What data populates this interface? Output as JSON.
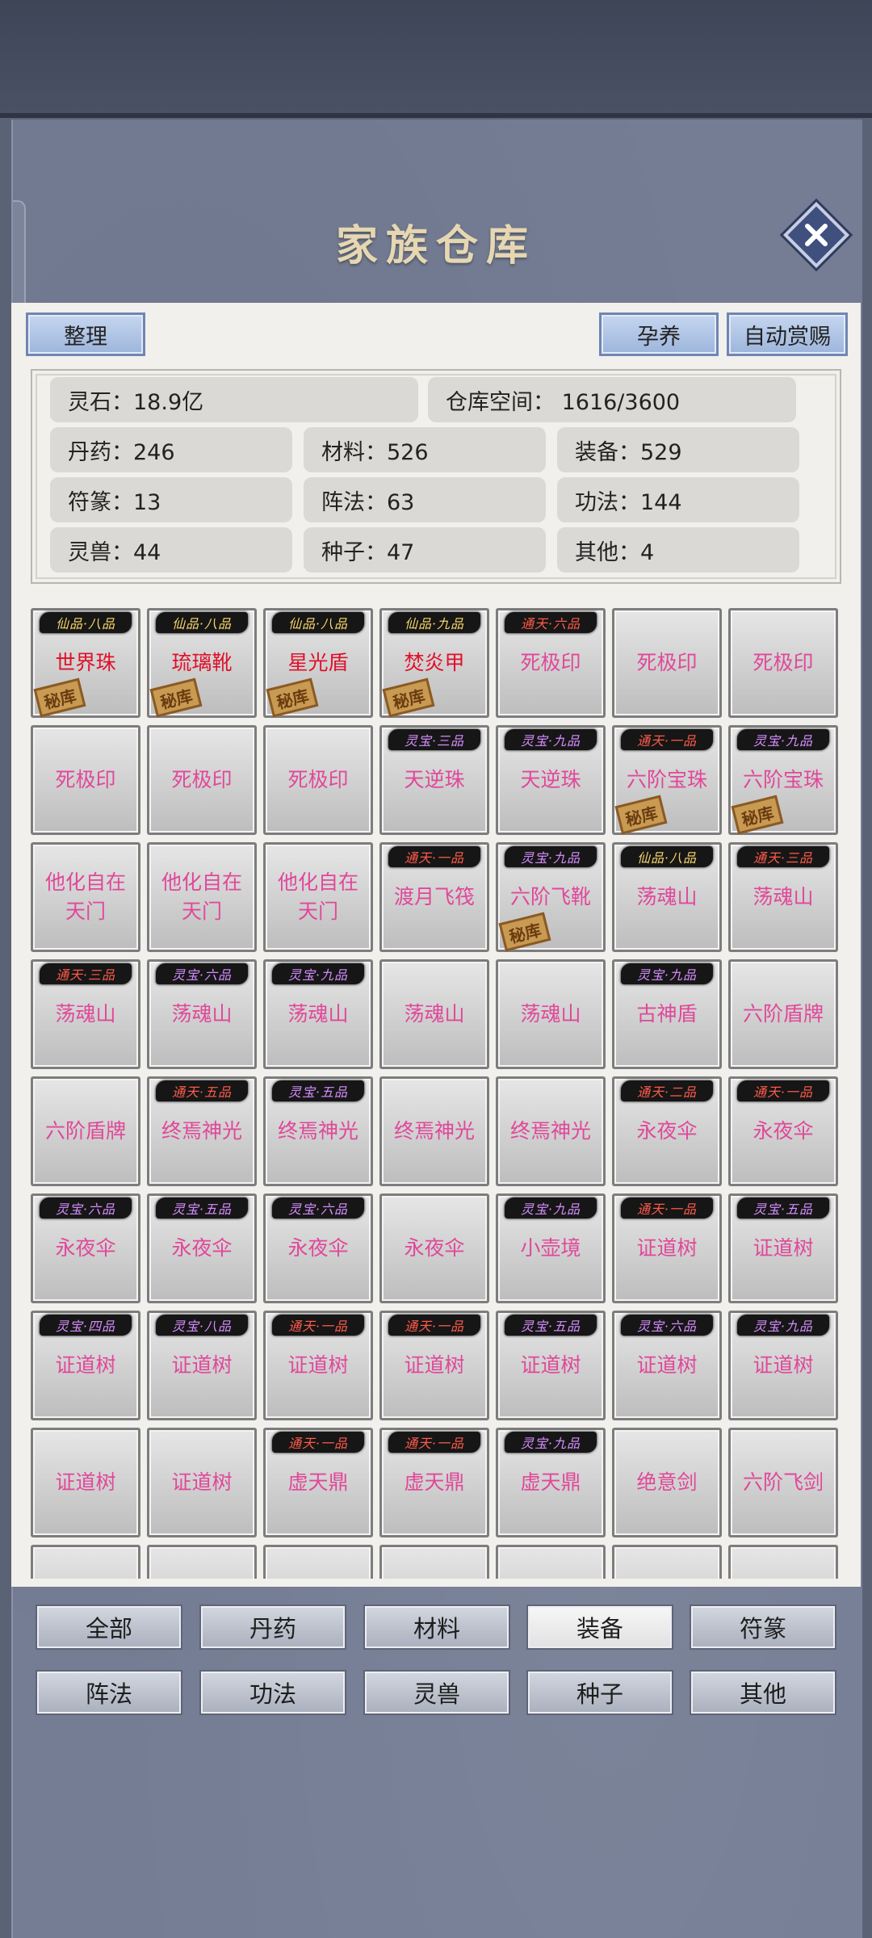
{
  "title": "家族仓库",
  "buttons": {
    "organize": "整理",
    "nurture": "孕养",
    "auto_reward": "自动赏赐"
  },
  "stats": {
    "spirit_stone": "灵石：18.9亿",
    "storage_space": "仓库空间：   1616/3600",
    "pills": "丹药：246",
    "materials": "材料：526",
    "equipment": "装备：529",
    "talismans": "符篆：13",
    "formations": "阵法：63",
    "techniques": "功法：144",
    "beasts": "灵兽：44",
    "seeds": "种子：47",
    "others": "其他：4"
  },
  "stamp_text": "秘库",
  "items": [
    {
      "badge": "仙品·八品",
      "badge_color": "gold",
      "name": "世界珠",
      "name_color": "red",
      "stamp": true
    },
    {
      "badge": "仙品·八品",
      "badge_color": "gold",
      "name": "琉璃靴",
      "name_color": "red",
      "stamp": true
    },
    {
      "badge": "仙品·八品",
      "badge_color": "gold",
      "name": "星光盾",
      "name_color": "red",
      "stamp": true
    },
    {
      "badge": "仙品·九品",
      "badge_color": "gold",
      "name": "焚炎甲",
      "name_color": "red",
      "stamp": true
    },
    {
      "badge": "通天·六品",
      "badge_color": "red",
      "name": "死极印",
      "name_color": "pink",
      "stamp": false
    },
    {
      "badge": "",
      "badge_color": "",
      "name": "死极印",
      "name_color": "pink",
      "stamp": false
    },
    {
      "badge": "",
      "badge_color": "",
      "name": "死极印",
      "name_color": "pink",
      "stamp": false
    },
    {
      "badge": "",
      "badge_color": "",
      "name": "死极印",
      "name_color": "pink",
      "stamp": false
    },
    {
      "badge": "",
      "badge_color": "",
      "name": "死极印",
      "name_color": "pink",
      "stamp": false
    },
    {
      "badge": "",
      "badge_color": "",
      "name": "死极印",
      "name_color": "pink",
      "stamp": false
    },
    {
      "badge": "灵宝·三品",
      "badge_color": "purple",
      "name": "天逆珠",
      "name_color": "pink",
      "stamp": false
    },
    {
      "badge": "灵宝·九品",
      "badge_color": "purple",
      "name": "天逆珠",
      "name_color": "pink",
      "stamp": false
    },
    {
      "badge": "通天·一品",
      "badge_color": "red",
      "name": "六阶宝珠",
      "name_color": "pink",
      "stamp": true
    },
    {
      "badge": "灵宝·九品",
      "badge_color": "purple",
      "name": "六阶宝珠",
      "name_color": "pink",
      "stamp": true
    },
    {
      "badge": "",
      "badge_color": "",
      "name": "他化自在天门",
      "name_color": "pink",
      "stamp": false
    },
    {
      "badge": "",
      "badge_color": "",
      "name": "他化自在天门",
      "name_color": "pink",
      "stamp": false
    },
    {
      "badge": "",
      "badge_color": "",
      "name": "他化自在天门",
      "name_color": "pink",
      "stamp": false
    },
    {
      "badge": "通天·一品",
      "badge_color": "red",
      "name": "渡月飞筏",
      "name_color": "pink",
      "stamp": false
    },
    {
      "badge": "灵宝·九品",
      "badge_color": "purple",
      "name": "六阶飞靴",
      "name_color": "pink",
      "stamp": true
    },
    {
      "badge": "仙品·八品",
      "badge_color": "gold",
      "name": "荡魂山",
      "name_color": "pink",
      "stamp": false
    },
    {
      "badge": "通天·三品",
      "badge_color": "red",
      "name": "荡魂山",
      "name_color": "pink",
      "stamp": false
    },
    {
      "badge": "通天·三品",
      "badge_color": "red",
      "name": "荡魂山",
      "name_color": "pink",
      "stamp": false
    },
    {
      "badge": "灵宝·六品",
      "badge_color": "purple",
      "name": "荡魂山",
      "name_color": "pink",
      "stamp": false
    },
    {
      "badge": "灵宝·九品",
      "badge_color": "purple",
      "name": "荡魂山",
      "name_color": "pink",
      "stamp": false
    },
    {
      "badge": "",
      "badge_color": "",
      "name": "荡魂山",
      "name_color": "pink",
      "stamp": false
    },
    {
      "badge": "",
      "badge_color": "",
      "name": "荡魂山",
      "name_color": "pink",
      "stamp": false
    },
    {
      "badge": "灵宝·九品",
      "badge_color": "purple",
      "name": "古神盾",
      "name_color": "pink",
      "stamp": false
    },
    {
      "badge": "",
      "badge_color": "",
      "name": "六阶盾牌",
      "name_color": "pink",
      "stamp": false
    },
    {
      "badge": "",
      "badge_color": "",
      "name": "六阶盾牌",
      "name_color": "pink",
      "stamp": false
    },
    {
      "badge": "通天·五品",
      "badge_color": "red",
      "name": "终焉神光",
      "name_color": "pink",
      "stamp": false
    },
    {
      "badge": "灵宝·五品",
      "badge_color": "purple",
      "name": "终焉神光",
      "name_color": "pink",
      "stamp": false
    },
    {
      "badge": "",
      "badge_color": "",
      "name": "终焉神光",
      "name_color": "pink",
      "stamp": false
    },
    {
      "badge": "",
      "badge_color": "",
      "name": "终焉神光",
      "name_color": "pink",
      "stamp": false
    },
    {
      "badge": "通天·二品",
      "badge_color": "red",
      "name": "永夜伞",
      "name_color": "pink",
      "stamp": false
    },
    {
      "badge": "通天·一品",
      "badge_color": "red",
      "name": "永夜伞",
      "name_color": "pink",
      "stamp": false
    },
    {
      "badge": "灵宝·六品",
      "badge_color": "purple",
      "name": "永夜伞",
      "name_color": "pink",
      "stamp": false
    },
    {
      "badge": "灵宝·五品",
      "badge_color": "purple",
      "name": "永夜伞",
      "name_color": "pink",
      "stamp": false
    },
    {
      "badge": "灵宝·六品",
      "badge_color": "purple",
      "name": "永夜伞",
      "name_color": "pink",
      "stamp": false
    },
    {
      "badge": "",
      "badge_color": "",
      "name": "永夜伞",
      "name_color": "pink",
      "stamp": false
    },
    {
      "badge": "灵宝·九品",
      "badge_color": "purple",
      "name": "小壶境",
      "name_color": "pink",
      "stamp": false
    },
    {
      "badge": "通天·一品",
      "badge_color": "red",
      "name": "证道树",
      "name_color": "pink",
      "stamp": false
    },
    {
      "badge": "灵宝·五品",
      "badge_color": "purple",
      "name": "证道树",
      "name_color": "pink",
      "stamp": false
    },
    {
      "badge": "灵宝·四品",
      "badge_color": "purple",
      "name": "证道树",
      "name_color": "pink",
      "stamp": false
    },
    {
      "badge": "灵宝·八品",
      "badge_color": "purple",
      "name": "证道树",
      "name_color": "pink",
      "stamp": false
    },
    {
      "badge": "通天·一品",
      "badge_color": "red",
      "name": "证道树",
      "name_color": "pink",
      "stamp": false
    },
    {
      "badge": "通天·一品",
      "badge_color": "red",
      "name": "证道树",
      "name_color": "pink",
      "stamp": false
    },
    {
      "badge": "灵宝·五品",
      "badge_color": "purple",
      "name": "证道树",
      "name_color": "pink",
      "stamp": false
    },
    {
      "badge": "灵宝·六品",
      "badge_color": "purple",
      "name": "证道树",
      "name_color": "pink",
      "stamp": false
    },
    {
      "badge": "灵宝·九品",
      "badge_color": "purple",
      "name": "证道树",
      "name_color": "pink",
      "stamp": false
    },
    {
      "badge": "",
      "badge_color": "",
      "name": "证道树",
      "name_color": "pink",
      "stamp": false
    },
    {
      "badge": "",
      "badge_color": "",
      "name": "证道树",
      "name_color": "pink",
      "stamp": false
    },
    {
      "badge": "通天·一品",
      "badge_color": "red",
      "name": "虚天鼎",
      "name_color": "pink",
      "stamp": false
    },
    {
      "badge": "通天·一品",
      "badge_color": "red",
      "name": "虚天鼎",
      "name_color": "pink",
      "stamp": false
    },
    {
      "badge": "灵宝·九品",
      "badge_color": "purple",
      "name": "虚天鼎",
      "name_color": "pink",
      "stamp": false
    },
    {
      "badge": "",
      "badge_color": "",
      "name": "绝意剑",
      "name_color": "pink",
      "stamp": false
    },
    {
      "badge": "",
      "badge_color": "",
      "name": "六阶飞剑",
      "name_color": "pink",
      "stamp": false
    }
  ],
  "tabs": [
    "全部",
    "丹药",
    "材料",
    "装备",
    "符篆",
    "阵法",
    "功法",
    "灵兽",
    "种子",
    "其他"
  ],
  "active_tab": "装备",
  "colors": {
    "background": "#5a6276",
    "content_bg": "#f2f0ec",
    "name_pink": "#e0489a",
    "name_red": "#e0102a",
    "title_gold": "#e6d7b2"
  }
}
